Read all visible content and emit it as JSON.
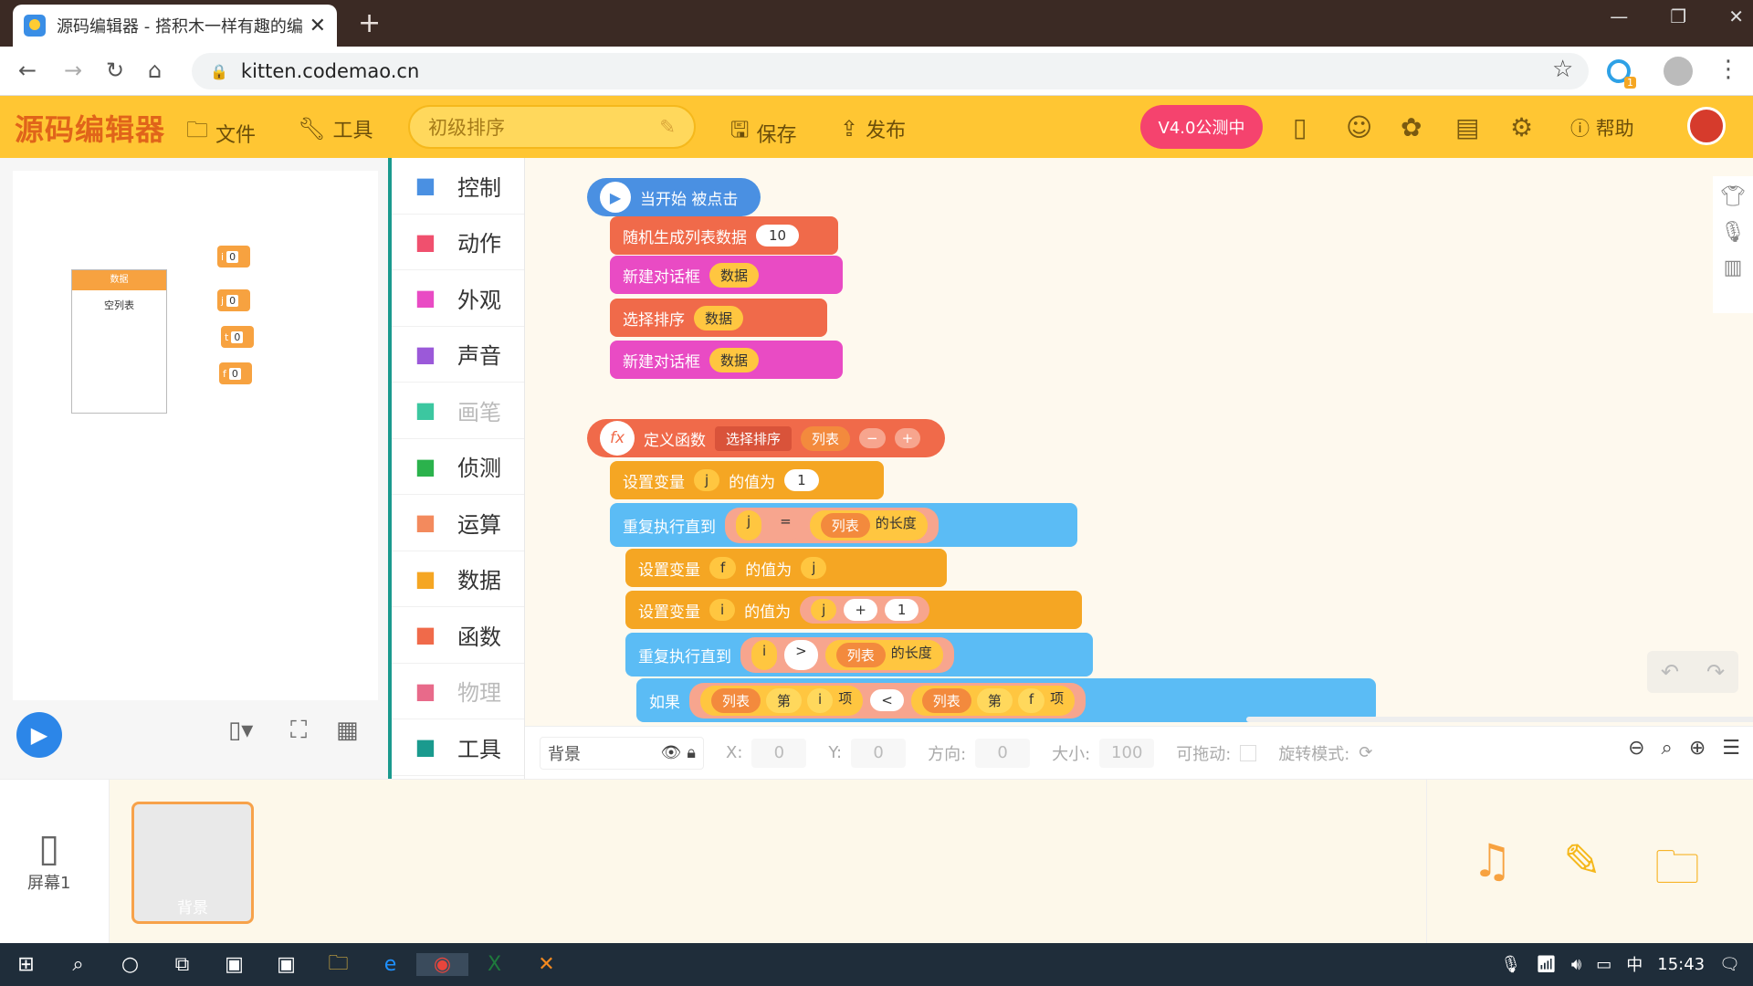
{
  "browser": {
    "tab_title": "源码编辑器 - 搭积木一样有趣的编",
    "url": "kitten.codemao.cn",
    "extension_badge": "1"
  },
  "app": {
    "logo": "源码编辑器",
    "menu_file": "文件",
    "menu_tools": "工具",
    "project_name": "初级排序",
    "save": "保存",
    "publish": "发布",
    "beta": "V4.0公测中",
    "help": "帮助"
  },
  "stage": {
    "list_monitor": {
      "title": "数据",
      "body": "空列表"
    },
    "vars": [
      {
        "name": "i",
        "value": "0"
      },
      {
        "name": "j",
        "value": "0"
      },
      {
        "name": "t",
        "value": "0"
      },
      {
        "name": "f",
        "value": "0"
      }
    ]
  },
  "categories": [
    {
      "label": "控制",
      "icon": "gamepad-icon",
      "color": "#4a90e2",
      "dim": false
    },
    {
      "label": "动作",
      "icon": "ghost-icon",
      "color": "#f0506e",
      "dim": false
    },
    {
      "label": "外观",
      "icon": "shirt-icon",
      "color": "#e94bc4",
      "dim": false
    },
    {
      "label": "声音",
      "icon": "mic-icon",
      "color": "#9b59d9",
      "dim": false
    },
    {
      "label": "画笔",
      "icon": "brush-icon",
      "color": "#3cc7a0",
      "dim": true
    },
    {
      "label": "侦测",
      "icon": "radar-icon",
      "color": "#2bb24c",
      "dim": false
    },
    {
      "label": "运算",
      "icon": "calc-icon",
      "color": "#f38a5d",
      "dim": false
    },
    {
      "label": "数据",
      "icon": "bar-chart-icon",
      "color": "#f5a623",
      "dim": false
    },
    {
      "label": "函数",
      "icon": "function-icon",
      "color": "#f06a4a",
      "dim": false
    },
    {
      "label": "物理",
      "icon": "magnet-icon",
      "color": "#e86a8a",
      "dim": true
    },
    {
      "label": "工具",
      "icon": "tools-icon",
      "color": "#1a9a8e",
      "dim": false
    }
  ],
  "script1": {
    "hat": "当开始 被点击",
    "b1_label": "随机生成列表数据",
    "b1_value": "10",
    "b2_label": "新建对话框",
    "b2_dropdown": "数据",
    "b3_label": "选择排序",
    "b3_dropdown": "数据",
    "b4_label": "新建对话框",
    "b4_dropdown": "数据"
  },
  "script2": {
    "def_label": "定义函数",
    "func_name": "选择排序",
    "param": "列表",
    "minus": "−",
    "plus": "+",
    "set1_label": "设置变量",
    "set1_var": "j",
    "set1_mid": "的值为",
    "set1_val": "1",
    "rep1_label": "重复执行直到",
    "rep1_var": "j",
    "rep1_op": "=",
    "rep1_list": "列表",
    "rep1_len": "的长度",
    "set2_label": "设置变量",
    "set2_var": "f",
    "set2_mid": "的值为",
    "set2_val": "j",
    "set3_label": "设置变量",
    "set3_var": "i",
    "set3_mid": "的值为",
    "set3_a": "j",
    "set3_op": "+",
    "set3_b": "1",
    "rep2_label": "重复执行直到",
    "rep2_var": "i",
    "rep2_op": ">",
    "rep2_list": "列表",
    "rep2_len": "的长度",
    "if_label": "如果",
    "if_list1": "列表",
    "if_nth1": "第",
    "if_idx1": "i",
    "if_item1": "项",
    "if_op": "<",
    "if_list2": "列表",
    "if_nth2": "第",
    "if_idx2": "f",
    "if_item2": "项"
  },
  "props": {
    "sprite": "背景",
    "x_label": "X:",
    "x": "0",
    "y_label": "Y:",
    "y": "0",
    "dir_label": "方向:",
    "dir": "0",
    "size_label": "大小:",
    "size": "100",
    "drag_label": "可拖动:",
    "rot_label": "旋转模式:"
  },
  "bottom": {
    "screen_label": "屏幕1",
    "bg_label": "背景"
  },
  "taskbar": {
    "ime": "中",
    "time": "15:43"
  },
  "colors": {
    "toolbar": "#ffc633",
    "control": "#4a90e2",
    "event": "#4a90e2",
    "func": "#f06a4a",
    "data": "#f5a623",
    "operator": "#f38a5d",
    "loop": "#5bbcf5"
  }
}
